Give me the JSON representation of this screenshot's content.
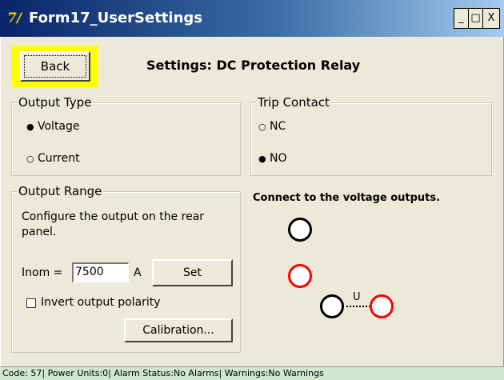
{
  "window": {
    "title": "Form17_UserSettings",
    "min_glyph": "_",
    "max_glyph": "□",
    "close_glyph": "X"
  },
  "header": {
    "back_label": "Back",
    "heading": "Settings: DC Protection Relay"
  },
  "output_type": {
    "title": "Output Type",
    "options": [
      {
        "label": "Voltage",
        "selected": true
      },
      {
        "label": "Current",
        "selected": false
      }
    ]
  },
  "trip_contact": {
    "title": "Trip Contact",
    "options": [
      {
        "label": "NC",
        "selected": false
      },
      {
        "label": "NO",
        "selected": true
      }
    ]
  },
  "output_range": {
    "title": "Output Range",
    "description": "Configure the output on the rear panel.",
    "inom_label": "Inom =",
    "inom_value": "7500",
    "unit": "A",
    "set_label": "Set",
    "invert_label": "Invert output polarity",
    "invert_checked": false,
    "calibration_label": "Calibration..."
  },
  "diagram": {
    "caption": "Connect to the voltage outputs.",
    "u_label": "U"
  },
  "status": {
    "text": "Code: 57| Power Units:0| Alarm Status:No Alarms| Warnings:No Warnings"
  },
  "colors": {
    "title_gradient_start": "#0a246a",
    "title_gradient_end": "#a6caf0",
    "highlight": "#ffff00",
    "terminal_black": "#000000",
    "terminal_red": "#ff0000",
    "statusbar": "#cfe6cf"
  }
}
